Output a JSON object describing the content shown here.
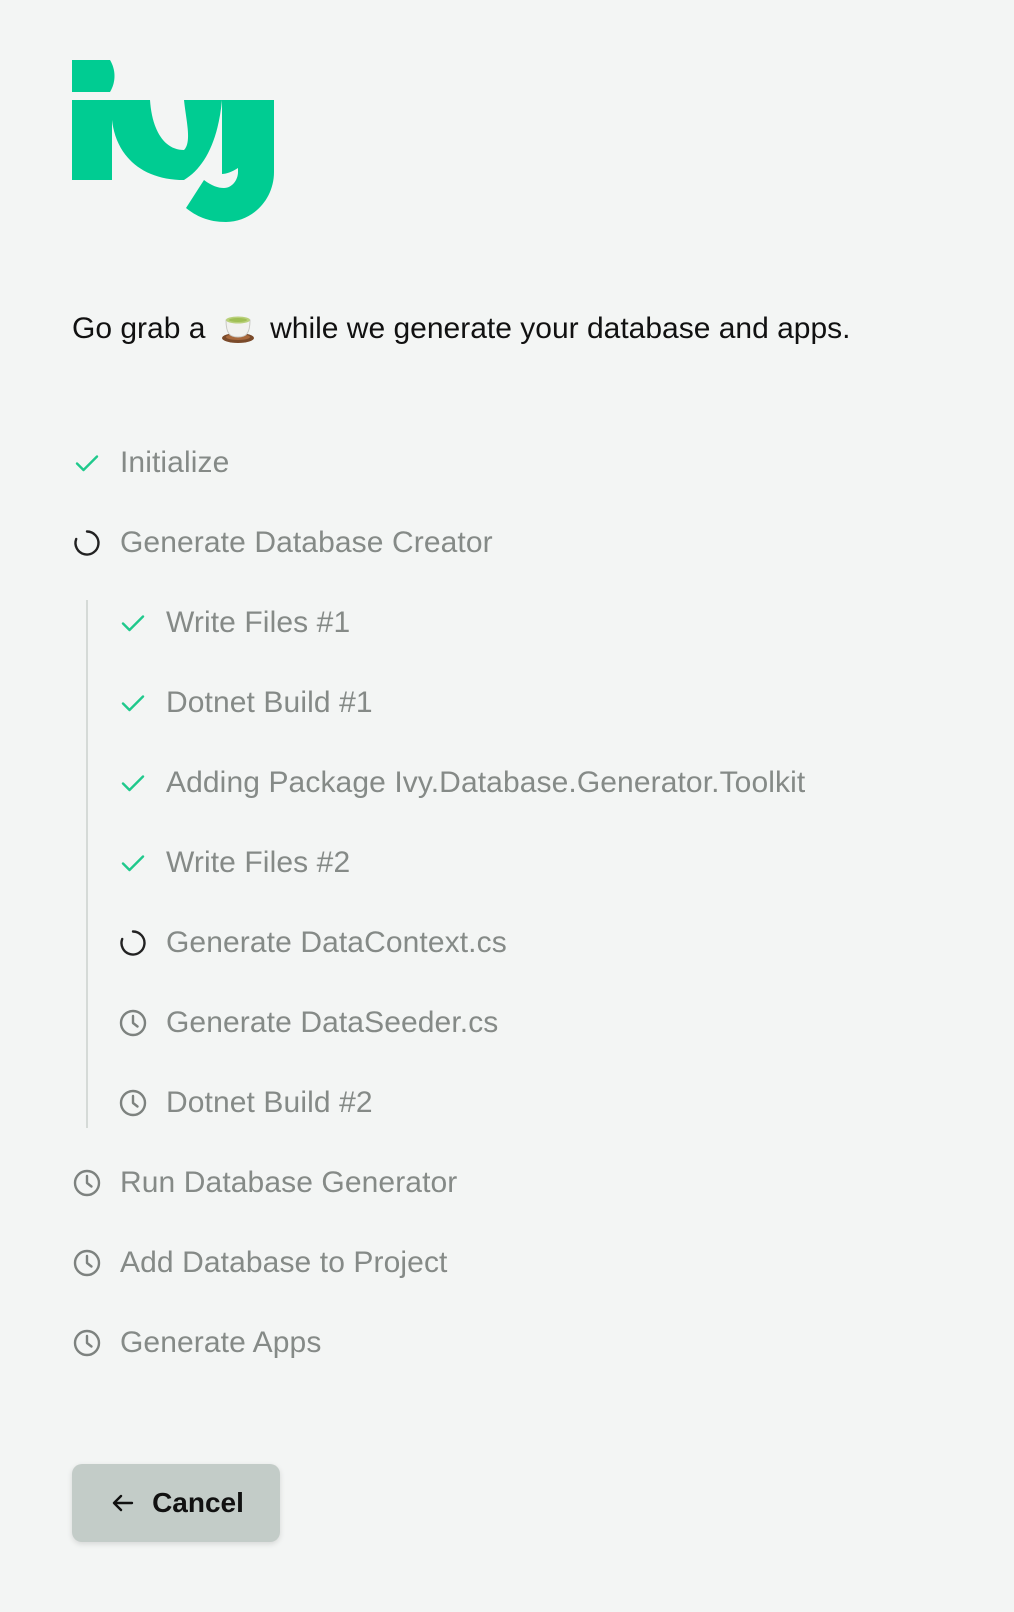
{
  "brand": {
    "name": "Ivy",
    "color": "#00cc92"
  },
  "intro": {
    "before": "Go grab a",
    "emoji": "teacup-emoji",
    "after": "while we generate your database and apps."
  },
  "steps": [
    {
      "label": "Initialize",
      "status": "done",
      "level": 0
    },
    {
      "label": "Generate Database Creator",
      "status": "running",
      "level": 0
    },
    {
      "label": "Write Files #1",
      "status": "done",
      "level": 1
    },
    {
      "label": "Dotnet Build #1",
      "status": "done",
      "level": 1
    },
    {
      "label": "Adding Package Ivy.Database.Generator.Toolkit",
      "status": "done",
      "level": 1
    },
    {
      "label": "Write Files #2",
      "status": "done",
      "level": 1
    },
    {
      "label": "Generate DataContext.cs",
      "status": "running",
      "level": 1
    },
    {
      "label": "Generate DataSeeder.cs",
      "status": "pending",
      "level": 1
    },
    {
      "label": "Dotnet Build #2",
      "status": "pending",
      "level": 1
    },
    {
      "label": "Run Database Generator",
      "status": "pending",
      "level": 0
    },
    {
      "label": "Add Database to Project",
      "status": "pending",
      "level": 0
    },
    {
      "label": "Generate Apps",
      "status": "pending",
      "level": 0
    }
  ],
  "colors": {
    "done": "#1fc98c",
    "running": "#222222",
    "pending": "#7d827f",
    "label": "#858a87"
  },
  "cancel": {
    "label": "Cancel",
    "icon": "arrow-left-icon"
  }
}
